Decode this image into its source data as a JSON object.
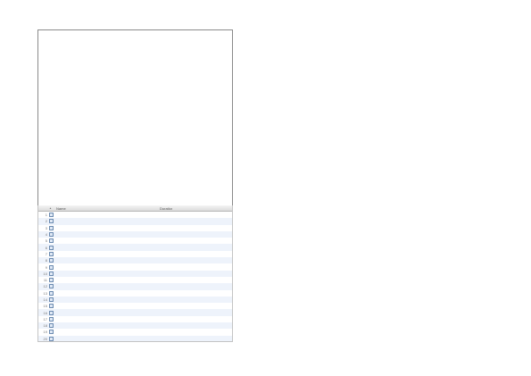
{
  "track_list": {
    "columns": {
      "number": "",
      "name": "Name",
      "duration": "Duration",
      "artist": ""
    },
    "rows": [
      {
        "number": "1",
        "name": "",
        "duration": "",
        "artist": ""
      },
      {
        "number": "2",
        "name": "",
        "duration": "",
        "artist": ""
      },
      {
        "number": "3",
        "name": "",
        "duration": "",
        "artist": ""
      },
      {
        "number": "4",
        "name": "",
        "duration": "",
        "artist": ""
      },
      {
        "number": "5",
        "name": "",
        "duration": "",
        "artist": ""
      },
      {
        "number": "6",
        "name": "",
        "duration": "",
        "artist": ""
      },
      {
        "number": "7",
        "name": "",
        "duration": "",
        "artist": ""
      },
      {
        "number": "8",
        "name": "",
        "duration": "",
        "artist": ""
      },
      {
        "number": "9",
        "name": "",
        "duration": "",
        "artist": ""
      },
      {
        "number": "10",
        "name": "",
        "duration": "",
        "artist": ""
      },
      {
        "number": "11",
        "name": "",
        "duration": "",
        "artist": ""
      },
      {
        "number": "12",
        "name": "",
        "duration": "",
        "artist": ""
      },
      {
        "number": "13",
        "name": "",
        "duration": "",
        "artist": ""
      },
      {
        "number": "14",
        "name": "",
        "duration": "",
        "artist": ""
      },
      {
        "number": "15",
        "name": "",
        "duration": "",
        "artist": ""
      },
      {
        "number": "16",
        "name": "",
        "duration": "",
        "artist": ""
      },
      {
        "number": "17",
        "name": "",
        "duration": "",
        "artist": ""
      },
      {
        "number": "18",
        "name": "",
        "duration": "",
        "artist": ""
      },
      {
        "number": "19",
        "name": "",
        "duration": "",
        "artist": ""
      },
      {
        "number": "20",
        "name": "",
        "duration": "",
        "artist": ""
      }
    ]
  }
}
